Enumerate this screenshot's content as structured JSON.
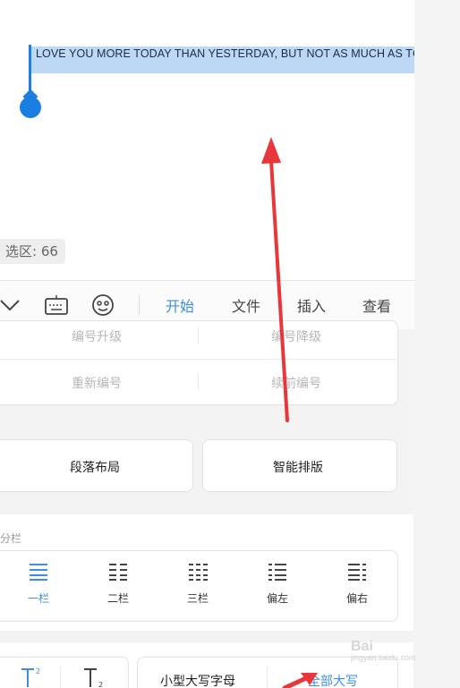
{
  "document": {
    "selected_text": "LOVE YOU MORE TODAY THAN YESTERDAY, BUT NOT AS MUCH AS TC",
    "selection_count": "选区: 66"
  },
  "toolbar": {
    "tabs": [
      {
        "label": "开始",
        "active": true
      },
      {
        "label": "文件",
        "active": false
      },
      {
        "label": "插入",
        "active": false
      },
      {
        "label": "查看",
        "active": false
      }
    ],
    "icons": [
      "chevron-down-icon",
      "keyboard-icon",
      "emoji-icon"
    ]
  },
  "numbering": {
    "promote": "编号升级",
    "demote": "编号降级",
    "restart": "重新编号",
    "continue": "续前编号"
  },
  "layout_buttons": {
    "paragraph": "段落布局",
    "smart": "智能排版"
  },
  "columns": {
    "title": "分栏",
    "items": [
      {
        "label": "一栏",
        "active": true
      },
      {
        "label": "二栏",
        "active": false
      },
      {
        "label": "三栏",
        "active": false
      },
      {
        "label": "偏左",
        "active": false
      },
      {
        "label": "偏右",
        "active": false
      }
    ]
  },
  "case_buttons": {
    "small_caps": "小型大写字母",
    "all_caps": "全部大写"
  },
  "watermark": {
    "brand": "Bai",
    "sub": "jingyan.baidu.com"
  },
  "colors": {
    "accent": "#3a8ee6",
    "selection": "#bcd8f5",
    "annotation_arrow": "#e8363a"
  }
}
